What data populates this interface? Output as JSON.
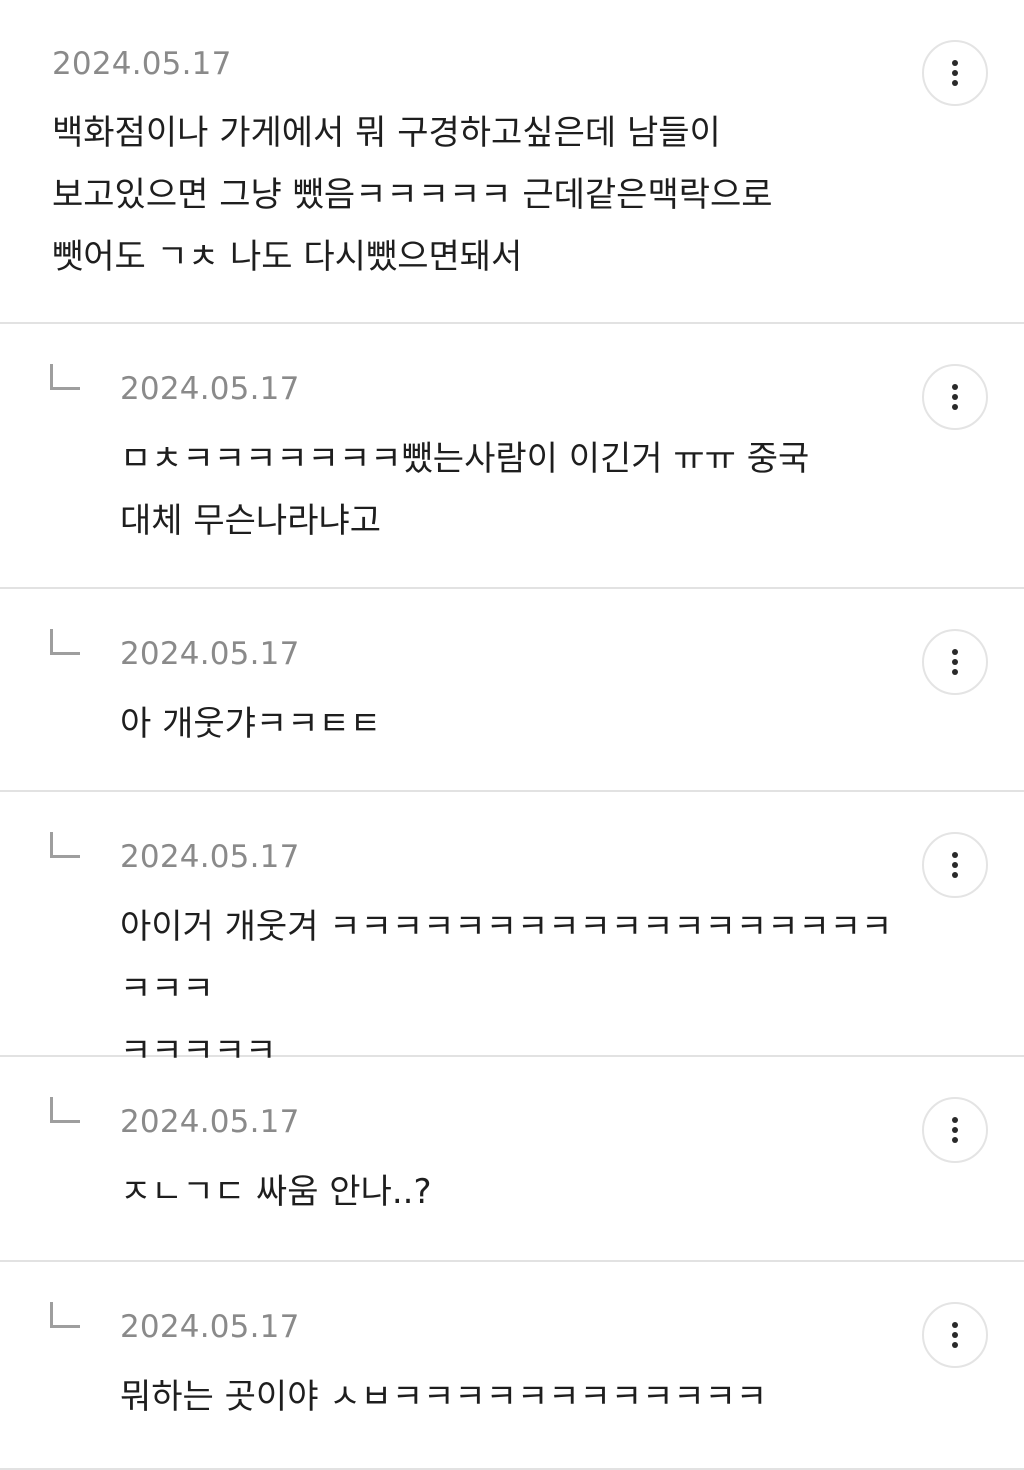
{
  "comments": [
    {
      "date": "2024.05.17",
      "text": "백화점이나 가게에서 뭐 구경하고싶은데 남들이\n보고있으면 그냥 뺐음ㅋㅋㅋㅋㅋ 근데같은맥락으로\n뺏어도 ㄱㅊ 나도 다시뺐으면돼서",
      "is_reply": false
    },
    {
      "date": "2024.05.17",
      "text": "ㅁㅊㅋㅋㅋㅋㅋㅋㅋ뺐는사람이 이긴거 ㅠㅠ 중국\n대체 무슨나라냐고",
      "is_reply": true
    },
    {
      "date": "2024.05.17",
      "text": "아 개웃갸ㅋㅋㅌㅌ",
      "is_reply": true
    },
    {
      "date": "2024.05.17",
      "text": "아이거 개웃겨 ㅋㅋㅋㅋㅋㅋㅋㅋㅋㅋㅋㅋㅋㅋㅋㅋㅋㅋㅋㅋㅋ\nㅋㅋㅋㅋㅋ",
      "is_reply": true
    },
    {
      "date": "2024.05.17",
      "text": "ㅈㄴㄱㄷ 싸움 안나..?",
      "is_reply": true
    },
    {
      "date": "2024.05.17",
      "text": "뭐하는 곳이야 ㅅㅂㅋㅋㅋㅋㅋㅋㅋㅋㅋㅋㅋㅋ",
      "is_reply": true
    }
  ],
  "icons": {
    "more": "vertical-ellipsis-icon",
    "reply": "reply-arrow-icon"
  },
  "colors": {
    "date": "#8a8a8a",
    "text": "#1e1e1e",
    "divider": "#e2e2e2",
    "button_border": "#e4e4e4"
  }
}
